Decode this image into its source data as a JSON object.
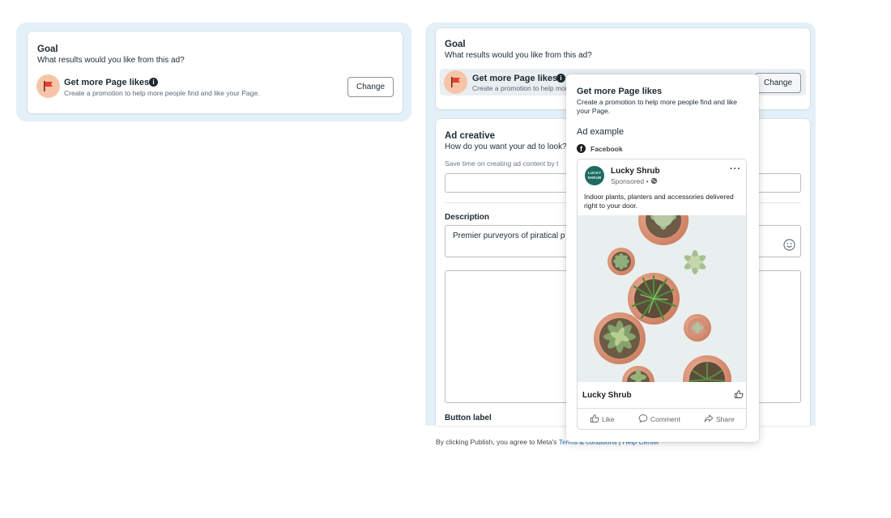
{
  "goal_card_left": {
    "title": "Goal",
    "subtitle": "What results would you like from this ad?",
    "goal_name": "Get more Page likes",
    "goal_description": "Create a promotion to help more people find and like your Page.",
    "change_label": "Change"
  },
  "goal_card_right": {
    "title": "Goal",
    "subtitle": "What results would you like from this ad?",
    "goal_name": "Get more Page likes",
    "goal_description": "Create a promotion to help more people find and like your Page.",
    "change_label": "Change"
  },
  "ad_creative": {
    "title": "Ad creative",
    "subtitle": "How do you want your ad to look?",
    "hint": "Save time on creating ad content by t",
    "description_label": "Description",
    "description_value": "Premier purveyors of piratical p",
    "button_label": "Button label"
  },
  "footer": {
    "prefix": "By clicking Publish, you agree to Meta's",
    "terms_link": "Terms & conditions",
    "separator": "|",
    "help_link": "Help Center"
  },
  "popover": {
    "title": "Get more Page likes",
    "description": "Create a promotion to help more people find and like your Page.",
    "section_title": "Ad example",
    "platform": "Facebook",
    "ad": {
      "avatar_text": "LUCKY SHRUB",
      "page_name": "Lucky Shrub",
      "sponsored": "Sponsored •",
      "body": "Indoor plants, planters and accessories delivered right to your door.",
      "footer_name": "Lucky Shrub",
      "actions": [
        "Like",
        "Comment",
        "Share"
      ]
    }
  },
  "colors": {
    "panel_glow": "#e4f0f8",
    "flag_bg": "#f6c4a7",
    "flag_red": "#e4402b",
    "link_blue": "#2d6fb7",
    "avatar_green": "#1e6b62"
  },
  "icons": [
    "flag-icon",
    "info-icon",
    "smiley-icon",
    "facebook-icon",
    "globe-icon",
    "more-icon",
    "thumbs-up-icon",
    "like-icon",
    "comment-icon",
    "share-icon"
  ]
}
